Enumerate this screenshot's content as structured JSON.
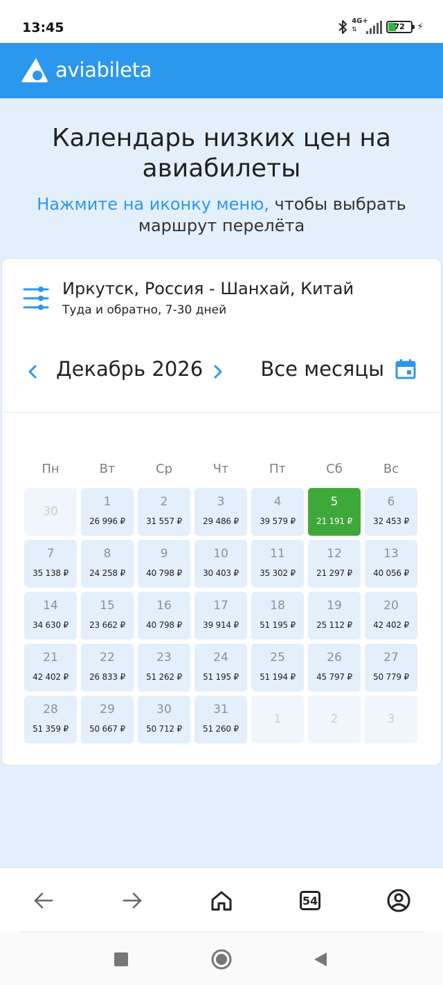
{
  "status_bar": {
    "time": "13:45",
    "network": "4G+",
    "battery": "72",
    "icons": [
      "bluetooth-icon",
      "signal-icon",
      "battery-icon",
      "charging-icon"
    ]
  },
  "header": {
    "logo_text": "aviabileta",
    "brand_color": "#2b97ee"
  },
  "hero": {
    "title": "Календарь низких цен на авиабилеты",
    "subtitle_accent": "Нажмите на иконку меню,",
    "subtitle_rest": " чтобы выбрать маршрут перелёта"
  },
  "route": {
    "title": "Иркутск, Россия - Шанхай, Китай",
    "subtitle": "Туда и обратно, 7-30 дней",
    "icon": "filter-icon"
  },
  "month_nav": {
    "month": "Декабрь 2026",
    "all_months": "Все месяцы",
    "icons": [
      "chevron-left-icon",
      "chevron-right-icon",
      "calendar-icon"
    ]
  },
  "weekdays": [
    "Пн",
    "Вт",
    "Ср",
    "Чт",
    "Пт",
    "Сб",
    "Вс"
  ],
  "days": [
    {
      "n": "30",
      "price": "",
      "state": "muted"
    },
    {
      "n": "1",
      "price": "26 996 ₽"
    },
    {
      "n": "2",
      "price": "31 557 ₽"
    },
    {
      "n": "3",
      "price": "29 486 ₽"
    },
    {
      "n": "4",
      "price": "39 579 ₽"
    },
    {
      "n": "5",
      "price": "21 191 ₽",
      "state": "best"
    },
    {
      "n": "6",
      "price": "32 453 ₽"
    },
    {
      "n": "7",
      "price": "35 138 ₽"
    },
    {
      "n": "8",
      "price": "24 258 ₽"
    },
    {
      "n": "9",
      "price": "40 798 ₽"
    },
    {
      "n": "10",
      "price": "30 403 ₽"
    },
    {
      "n": "11",
      "price": "35 302 ₽"
    },
    {
      "n": "12",
      "price": "21 297 ₽"
    },
    {
      "n": "13",
      "price": "40 056 ₽"
    },
    {
      "n": "14",
      "price": "34 630 ₽"
    },
    {
      "n": "15",
      "price": "23 662 ₽"
    },
    {
      "n": "16",
      "price": "40 798 ₽"
    },
    {
      "n": "17",
      "price": "39 914 ₽"
    },
    {
      "n": "18",
      "price": "51 195 ₽"
    },
    {
      "n": "19",
      "price": "25 112 ₽"
    },
    {
      "n": "20",
      "price": "42 402 ₽"
    },
    {
      "n": "21",
      "price": "42 402 ₽"
    },
    {
      "n": "22",
      "price": "26 833 ₽"
    },
    {
      "n": "23",
      "price": "51 262 ₽"
    },
    {
      "n": "24",
      "price": "51 195 ₽"
    },
    {
      "n": "25",
      "price": "51 194 ₽"
    },
    {
      "n": "26",
      "price": "45 797 ₽"
    },
    {
      "n": "27",
      "price": "50 779 ₽"
    },
    {
      "n": "28",
      "price": "51 359 ₽"
    },
    {
      "n": "29",
      "price": "50 667 ₽"
    },
    {
      "n": "30",
      "price": "50 712 ₽"
    },
    {
      "n": "31",
      "price": "51 260 ₽"
    },
    {
      "n": "1",
      "price": "",
      "state": "muted"
    },
    {
      "n": "2",
      "price": "",
      "state": "muted"
    },
    {
      "n": "3",
      "price": "",
      "state": "muted"
    }
  ],
  "colors": {
    "best_price": "#3fa83a",
    "day_bg": "#e4effc",
    "accent": "#2b97ee"
  },
  "browser_bar": {
    "tabs_count": "54",
    "icons": [
      "back-arrow-icon",
      "forward-arrow-icon",
      "home-icon",
      "tabs-icon",
      "account-icon"
    ]
  },
  "system_nav": {
    "icons": [
      "recents-icon",
      "home-circle-icon",
      "back-triangle-icon"
    ]
  }
}
